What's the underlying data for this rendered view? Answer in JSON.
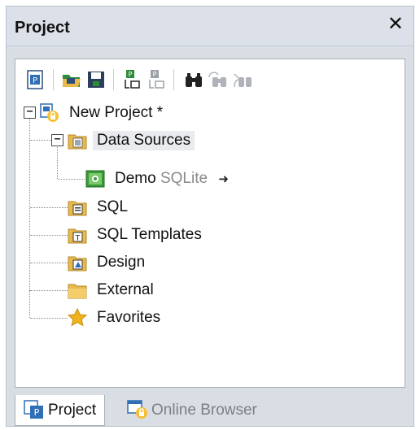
{
  "panel": {
    "title": "Project",
    "close_label": "✕"
  },
  "toolbar": {
    "buttons": [
      {
        "name": "new-project-icon"
      },
      {
        "name": "open-project-icon"
      },
      {
        "name": "save-project-icon"
      },
      {
        "name": "add-files-to-project-icon"
      },
      {
        "name": "add-active-file-to-project-icon"
      },
      {
        "name": "find-icon"
      },
      {
        "name": "find-next-icon"
      },
      {
        "name": "replace-icon"
      }
    ]
  },
  "tree": {
    "root": {
      "label": "New Project *",
      "expander": "−"
    },
    "data_sources": {
      "label": "Data Sources",
      "expander": "−"
    },
    "demo": {
      "label": "Demo",
      "type": "SQLite",
      "arrow": "➜"
    },
    "sql": {
      "label": "SQL"
    },
    "sql_templates": {
      "label": "SQL Templates"
    },
    "design": {
      "label": "Design"
    },
    "external": {
      "label": "External"
    },
    "favorites": {
      "label": "Favorites"
    }
  },
  "tabs": [
    {
      "label": "Project",
      "active": true
    },
    {
      "label": "Online Browser",
      "active": false
    }
  ],
  "colors": {
    "folder": "#e9b94c",
    "accent_blue": "#2f6fb6",
    "green": "#3a9a3a",
    "star": "#f1b31c"
  }
}
